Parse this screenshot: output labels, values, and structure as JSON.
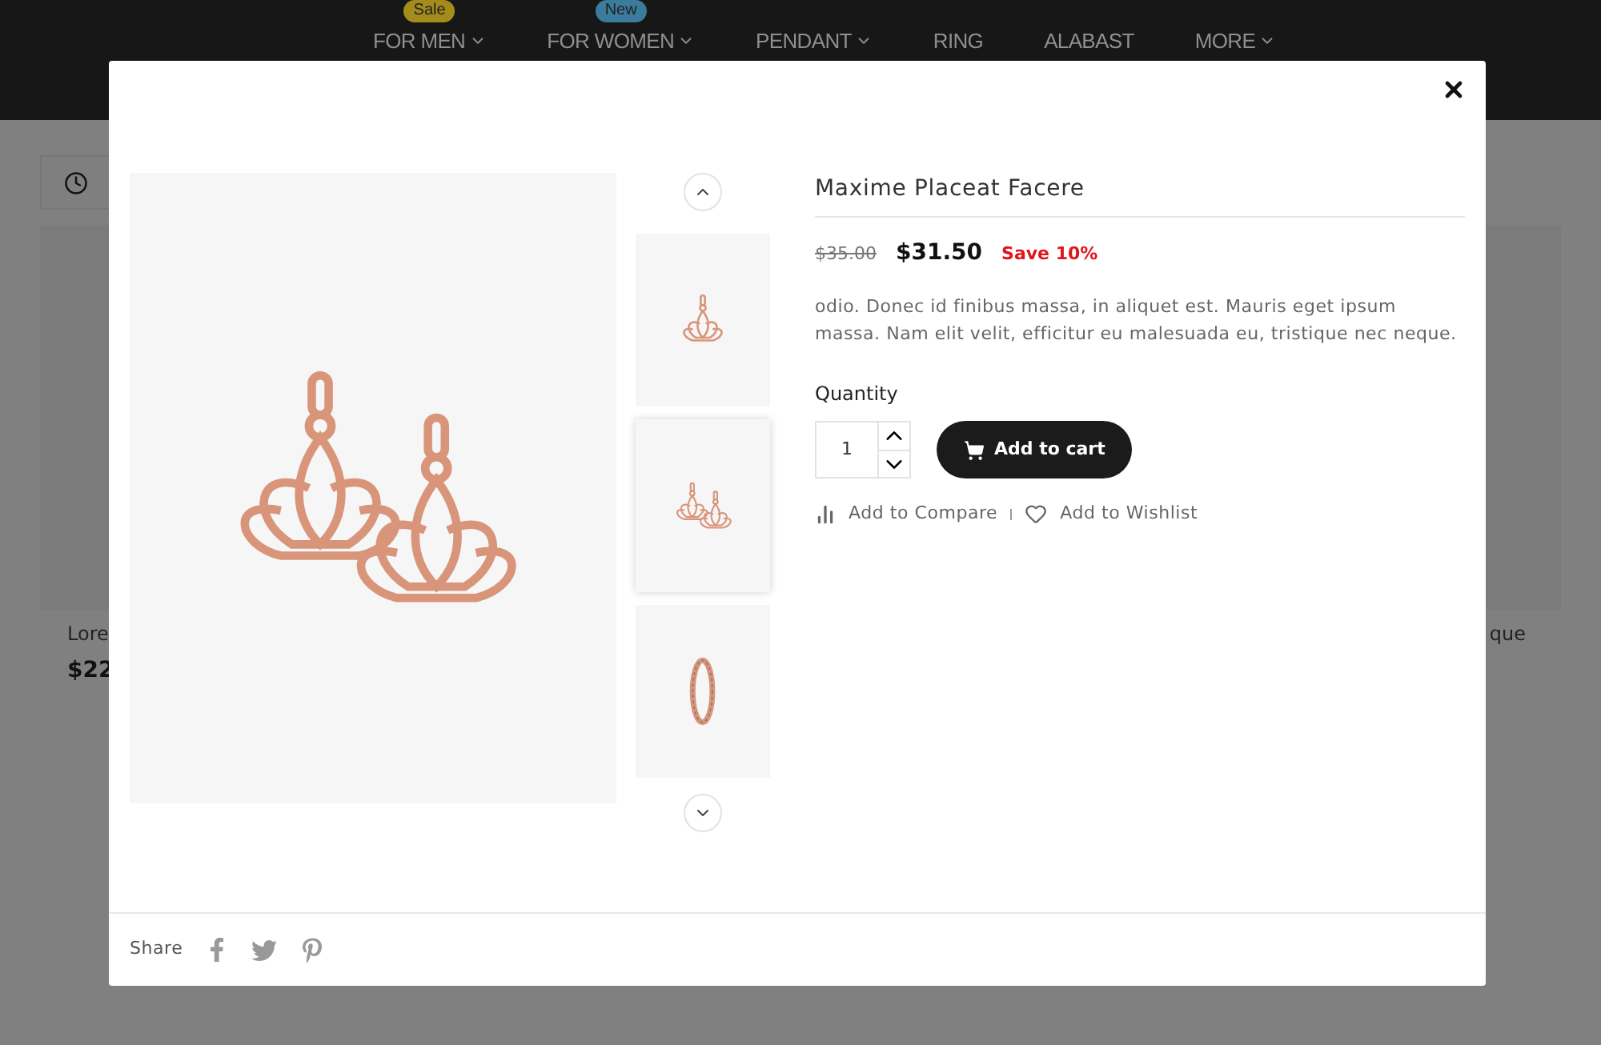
{
  "nav": {
    "items": [
      {
        "label": "FOR MEN",
        "caret": true,
        "badge": {
          "text": "Sale",
          "color": "#a48c1c"
        }
      },
      {
        "label": "FOR WOMEN",
        "caret": true,
        "badge": {
          "text": "New",
          "color": "#3b7b9b"
        }
      },
      {
        "label": "PENDANT",
        "caret": true
      },
      {
        "label": "RING",
        "caret": false
      },
      {
        "label": "ALABAST",
        "caret": false
      },
      {
        "label": "MORE",
        "caret": true
      }
    ]
  },
  "background": {
    "left_card": {
      "title": "Lore",
      "price": "$22"
    },
    "right_card": {
      "title": "que"
    }
  },
  "modal": {
    "title": "Maxime Placeat Facere",
    "old_price": "$35.00",
    "price": "$31.50",
    "discount": "Save 10%",
    "description": "odio. Donec id finibus massa, in aliquet est. Mauris eget ipsum massa. Nam elit velit, efficitur eu malesuada eu, tristique nec neque.",
    "quantity_label": "Quantity",
    "quantity": "1",
    "add_to_cart": "Add to cart",
    "actions": [
      {
        "kind": "compare",
        "label": "Add to Compare"
      },
      {
        "kind": "wishlist",
        "label": "Add to Wishlist"
      }
    ],
    "main_image": {
      "kind": "earrings"
    },
    "thumbnails": [
      {
        "kind": "earring",
        "selected": false
      },
      {
        "kind": "earrings",
        "selected": true
      },
      {
        "kind": "ring",
        "selected": false
      }
    ],
    "share_label": "Share",
    "share": [
      {
        "kind": "facebook"
      },
      {
        "kind": "twitter"
      },
      {
        "kind": "pinterest"
      }
    ]
  }
}
